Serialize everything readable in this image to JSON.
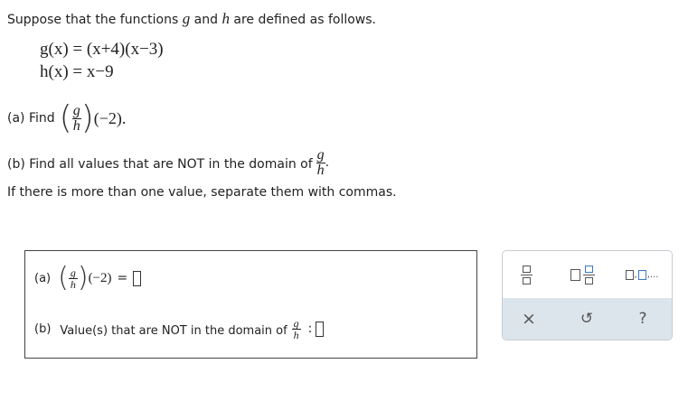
{
  "problem": {
    "intro": "Suppose that the functions",
    "g": "g",
    "and": "and",
    "h": "h",
    "intro_end": "are defined as follows.",
    "g_def": "g(x) = (x+4)(x−3)",
    "h_def": "h(x) = x−9",
    "part_a_label": "(a) Find",
    "part_a_arg": "(−2).",
    "part_b_text": "(b) Find all values that are NOT in the domain of",
    "part_b_end": ".",
    "instruction": "If there is more than one value, separate them with commas."
  },
  "answer": {
    "a_label": "(a)",
    "a_arg": "(−2)",
    "equals": "=",
    "b_label": "(b)",
    "b_text": "Value(s) that are NOT in the domain of",
    "colon": ":",
    "a_value": "",
    "b_value": ""
  },
  "toolbar": {
    "buttons": [
      "fraction-icon",
      "mixed-number-icon",
      "ellipsis-list-icon",
      "close-icon",
      "undo-icon",
      "help-icon"
    ],
    "ellipsis_text": "□,□,...",
    "close_glyph": "×",
    "undo_glyph": "↺",
    "help_glyph": "?",
    "accent": "#3a77c9"
  }
}
